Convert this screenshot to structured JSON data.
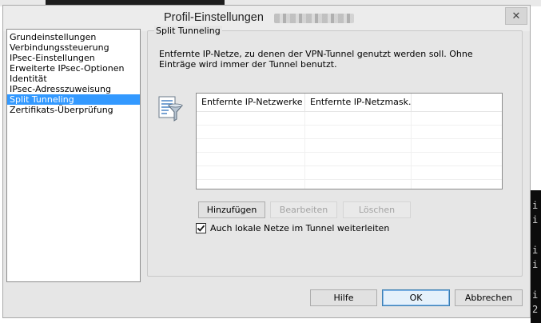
{
  "dialog": {
    "title": "Profil-Einstellungen",
    "close_glyph": "✕"
  },
  "nav": {
    "items": [
      {
        "label": "Grundeinstellungen",
        "selected": false
      },
      {
        "label": "Verbindungssteuerung",
        "selected": false
      },
      {
        "label": "IPsec-Einstellungen",
        "selected": false
      },
      {
        "label": "Erweiterte IPsec-Optionen",
        "selected": false
      },
      {
        "label": "Identität",
        "selected": false
      },
      {
        "label": "IPsec-Adresszuweisung",
        "selected": false
      },
      {
        "label": "Split Tunneling",
        "selected": true
      },
      {
        "label": "Zertifikats-Überprüfung",
        "selected": false
      }
    ]
  },
  "section": {
    "title": "Split Tunneling",
    "description": "Entfernte IP-Netze, zu denen der VPN-Tunnel genutzt werden soll. Ohne\nEinträge wird immer der Tunnel benutzt.",
    "icon": "filter-icon"
  },
  "table": {
    "columns": [
      "Entfernte IP-Netzwerke",
      "Entfernte IP-Netzmask..."
    ],
    "rows": []
  },
  "actions": {
    "add": "Hinzufügen",
    "edit": "Bearbeiten",
    "delete": "Löschen"
  },
  "checkbox": {
    "label": "Auch lokale Netze im Tunnel weiterleiten",
    "checked": true
  },
  "footer": {
    "help": "Hilfe",
    "ok": "OK",
    "cancel": "Abbrechen"
  },
  "background": {
    "terminal_chars": [
      "i",
      "i",
      "i",
      "i",
      "i",
      "2"
    ]
  },
  "colors": {
    "selection": "#3399ff",
    "dialog_bg": "#e6e6e6"
  }
}
